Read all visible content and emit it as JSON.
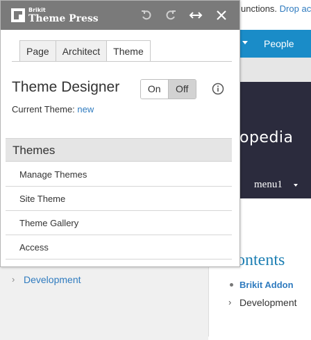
{
  "background": {
    "top_text": "unctions.",
    "top_link": "Drop ac",
    "nav_item": "People",
    "hero_brand": "opedia",
    "hero_menu": "menu1",
    "contents_title": "ontents",
    "toc": [
      {
        "label": "Brikit Addon"
      },
      {
        "label": "Development"
      }
    ],
    "tree_item": "Development"
  },
  "panel": {
    "logo_small": "Brikit",
    "logo_big": "Theme Press",
    "icons": [
      "undo-icon",
      "redo-icon",
      "expand-horizontal-icon",
      "close-icon"
    ],
    "tabs": [
      {
        "label": "Page",
        "active": false
      },
      {
        "label": "Architect",
        "active": false
      },
      {
        "label": "Theme",
        "active": true
      }
    ],
    "heading": "Theme Designer",
    "toggle": {
      "on_label": "On",
      "off_label": "Off",
      "selected": "Off"
    },
    "current_label": "Current Theme:",
    "current_value": "new",
    "section_title": "Themes",
    "menu_items": [
      {
        "label": "Manage Themes"
      },
      {
        "label": "Site Theme"
      },
      {
        "label": "Theme Gallery"
      },
      {
        "label": "Access"
      }
    ]
  },
  "colors": {
    "titlebar": "#7a7a7a",
    "link": "#2f7bbf",
    "nav": "#1a8cc8",
    "hero": "#2b2b3d"
  }
}
